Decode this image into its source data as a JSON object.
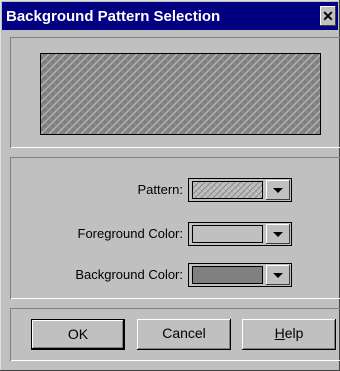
{
  "window": {
    "title": "Background Pattern Selection",
    "close_icon": "close-icon"
  },
  "controls": {
    "pattern_label": "Pattern:",
    "foreground_label": "Foreground Color:",
    "background_label": "Background Color:",
    "pattern_value": "diamond-plate",
    "foreground_color": "#c0c0c0",
    "background_color": "#808080"
  },
  "buttons": {
    "ok": "OK",
    "cancel": "Cancel",
    "help_mnemonic": "H",
    "help_rest": "elp"
  },
  "colors": {
    "title_bar": "#000080",
    "dialog_face": "#c0c0c0"
  }
}
